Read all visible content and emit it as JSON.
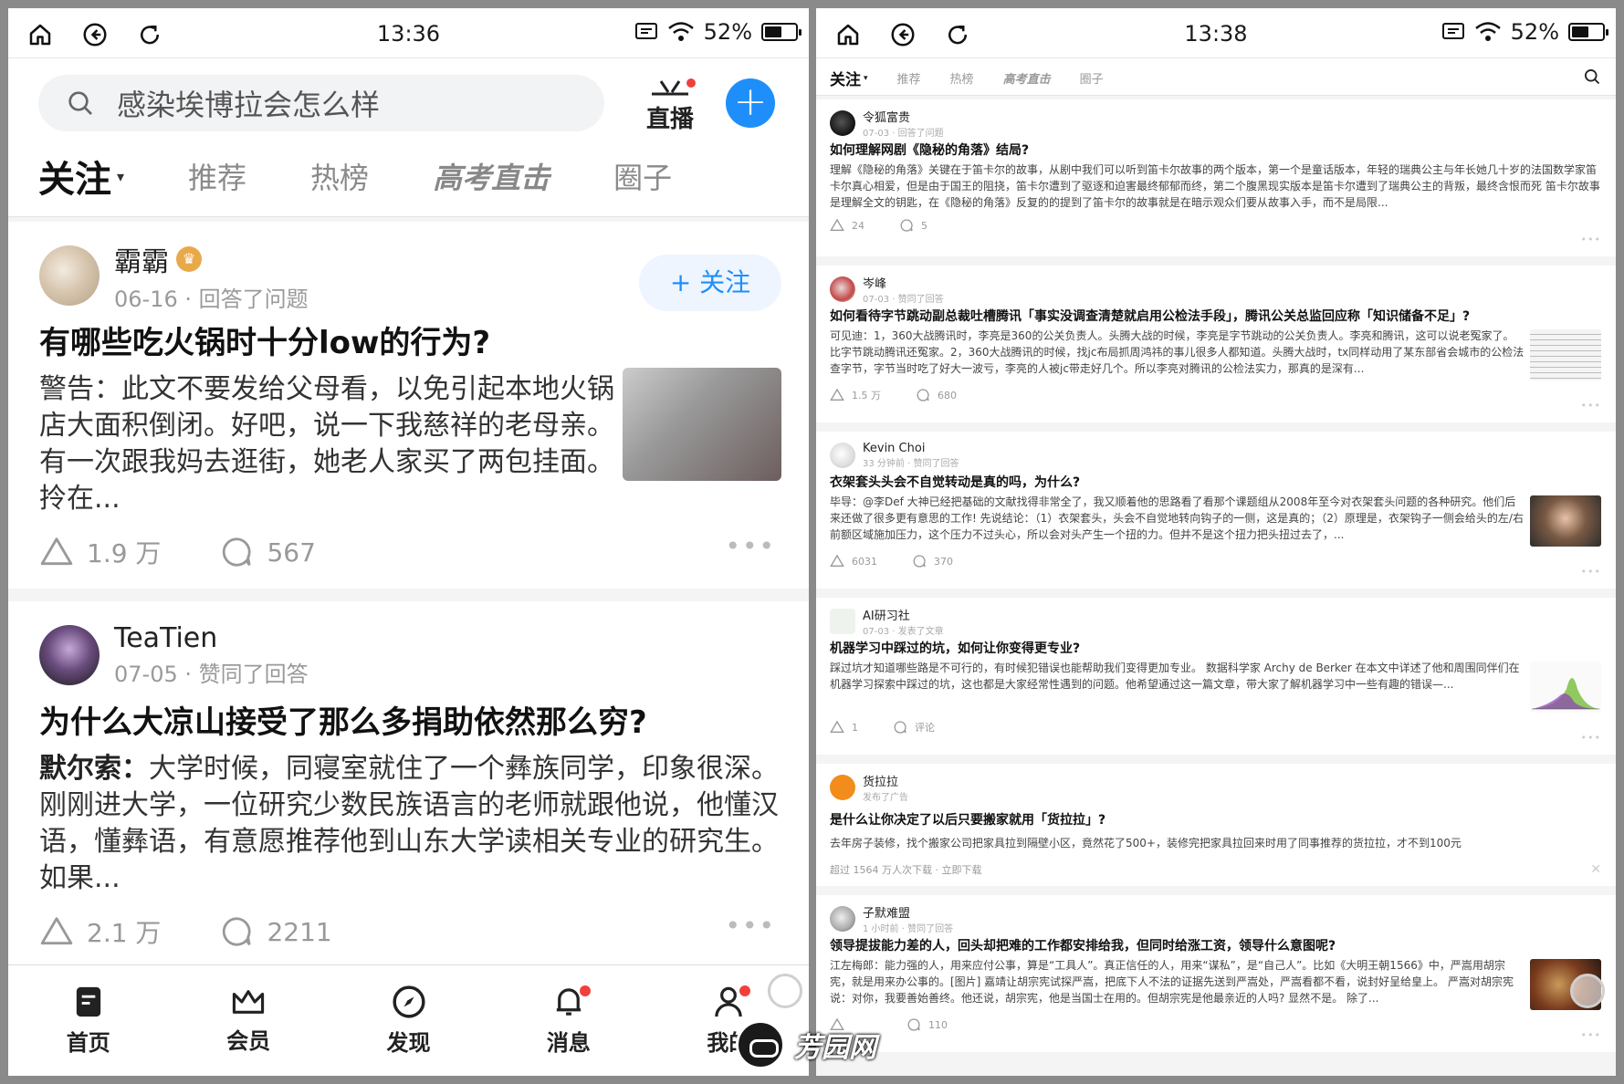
{
  "left": {
    "status": {
      "time": "13:36",
      "battery": "52%",
      "battery_level": 0.52
    },
    "search": {
      "placeholder": "感染埃博拉会怎么样"
    },
    "live_label": "直播",
    "tabs": [
      "关注",
      "推荐",
      "热榜",
      "高考直击",
      "圈子"
    ],
    "cards": [
      {
        "name": "霸霸",
        "meta": "06-16 · 回答了问题",
        "follow": "+ 关注",
        "title": "有哪些吃火锅时十分low的行为?",
        "excerpt": "警告：此文不要发给父母看，以免引起本地火锅店大面积倒闭。好吧，说一下我慈祥的老母亲。 有一次跟我妈去逛街，她老人家买了两包挂面。 拎在...",
        "likes": "1.9 万",
        "comments": "567"
      },
      {
        "name": "TeaTien",
        "meta": "07-05 · 赞同了回答",
        "title": "为什么大凉山接受了那么多捐助依然那么穷?",
        "excerpt_author": "默尔索：",
        "excerpt": "大学时候，同寝室就住了一个彝族同学，印象很深。 刚刚进大学，一位研究少数民族语言的老师就跟他说，他懂汉语，懂彝语，有意愿推荐他到山东大学读相关专业的研究生。如果...",
        "likes": "2.1 万",
        "comments": "2211"
      }
    ],
    "bottom_nav": [
      "首页",
      "会员",
      "发现",
      "消息",
      "我的"
    ]
  },
  "right": {
    "status": {
      "time": "13:38",
      "battery": "52%",
      "battery_level": 0.52
    },
    "tabs": [
      "关注",
      "推荐",
      "热榜",
      "高考直击",
      "圈子"
    ],
    "cards": [
      {
        "name": "令狐富贵",
        "meta": "07-03 · 回答了问题",
        "title": "如何理解网剧《隐秘的角落》结局?",
        "excerpt": "理解《隐秘的角落》关键在于笛卡尔的故事，从剧中我们可以听到笛卡尔故事的两个版本，第一个是童话版本，年轻的瑞典公主与年长她几十岁的法国数学家笛卡尔真心相爱，但是由于国王的阻挠，笛卡尔遭到了驱逐和迫害最终郁郁而终，第二个腹黑现实版本是笛卡尔遭到了瑞典公主的背叛，最终含恨而死 笛卡尔故事是理解全文的钥匙，在《隐秘的角落》反复的的提到了笛卡尔的故事就是在暗示观众们要从故事入手，而不是局限...",
        "likes": "24",
        "comments": "5"
      },
      {
        "name": "岑峰",
        "meta": "07-03 · 赞同了回答",
        "title": "如何看待字节跳动副总裁吐槽腾讯「事实没调查清楚就启用公检法手段」，腾讯公关总监回应称「知识储备不足」?",
        "excerpt": "可见迪：1，360大战腾讯时，李亮是360的公关负责人。头腾大战的时候，李亮是字节跳动的公关负责人。李亮和腾讯，这可以说老冤家了。比字节跳动腾讯还冤家。2，360大战腾讯的时候，找jc布局抓周鸿祎的事儿很多人都知道。头腾大战时，tx同样动用了某东部省会城市的公检法查字节，字节当时吃了好大一波亏，李亮的人被jc带走好几个。所以李亮对腾讯的公检法实力，那真的是深有...",
        "likes": "1.5 万",
        "comments": "680"
      },
      {
        "name": "Kevin Choi",
        "meta": "33 分钟前 · 赞同了回答",
        "title": "衣架套头头会不自觉转动是真的吗，为什么?",
        "excerpt": "毕导：@李Def 大神已经把基础的文献找得非常全了，我又顺着他的思路看了看那个课题组从2008年至今对衣架套头问题的各种研究。他们后来还做了很多更有意思的工作! 先说结论：（1）衣架套头，头会不自觉地转向钩子的一侧，这是真的；（2）原理是，衣架钩子一侧会给头的左/右前额区域施加压力，这个压力不过头心，所以会对头产生一个扭的力。但并不是这个扭力把头扭过去了，...",
        "likes": "6031",
        "comments": "370"
      },
      {
        "name": "AI研习社",
        "meta": "07-03 · 发表了文章",
        "title": "机器学习中踩过的坑，如何让你变得更专业?",
        "excerpt": "踩过坑才知道哪些路是不可行的，有时候犯错误也能帮助我们变得更加专业。 数据科学家 Archy de Berker 在本文中详述了他和周围同伴们在机器学习探索中踩过的坑，这也都是大家经常性遇到的问题。他希望通过这一篇文章，带大家了解机器学习中一些有趣的错误—...",
        "likes": "1",
        "comments": "评论"
      },
      {
        "name": "货拉拉",
        "meta": "发布了广告",
        "title": "是什么让你决定了以后只要搬家就用「货拉拉」?",
        "excerpt": "去年房子装修，找个搬家公司把家具拉到隔壁小区，竟然花了500+，装修完把家具拉回来时用了同事推荐的货拉拉，才不到100元",
        "ad_foot": "超过 1564 万人次下载 · 立即下载"
      },
      {
        "name": "子默难盟",
        "meta": "1 小时前 · 赞同了回答",
        "title": "领导提拔能力差的人，回头却把难的工作都安排给我，但同时给涨工资，领导什么意图呢?",
        "excerpt": "江左梅郎：能力强的人，用来应付公事，算是“工具人”。真正信任的人，用来“谋私”，是“自己人”。比如《大明王朝1566》中，严嵩用胡宗宪，就是用来办公事的。[图片] 嘉靖让胡宗宪试探严嵩，把底下人不法的证据先送到严嵩处，严嵩看都不看，说封好呈给皇上。 严嵩对胡宗宪说：对你，我要善始善终。他还说，胡宗宪，他是当国士在用的。但胡宗宪是他最亲近的人吗? 显然不是。 除了...",
        "comments": "110"
      }
    ]
  },
  "watermark": "芳园网",
  "colors": {
    "accent": "#1e8ffa",
    "red_dot": "#f1403c"
  }
}
